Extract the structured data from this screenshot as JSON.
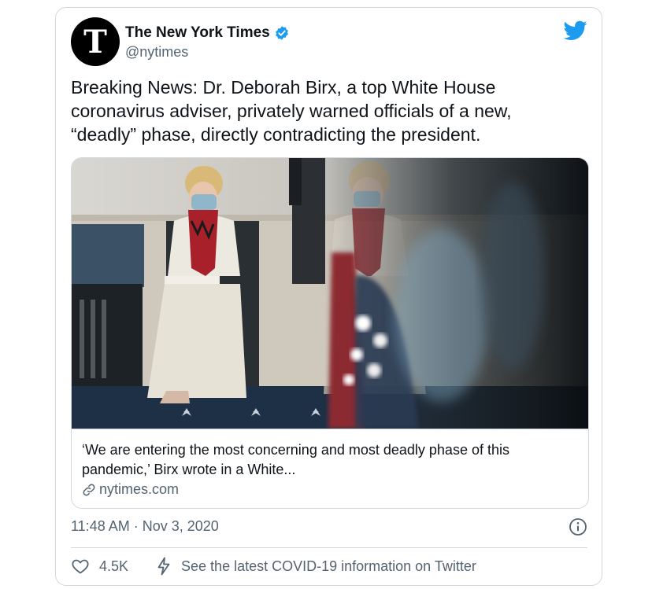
{
  "author": {
    "avatar_glyph": "T",
    "display_name": "The New York Times",
    "handle": "@nytimes",
    "verified": true
  },
  "tweet": {
    "text": "Breaking News: Dr. Deborah Birx, a top White House coronavirus adviser, privately warned officials of a new, “deadly” phase, directly contradicting the president."
  },
  "card": {
    "description": "‘We are entering the most concerning and most deadly phase of this pandemic,’ Birx wrote in a White...",
    "domain": "nytimes.com"
  },
  "meta": {
    "timestamp": "11:48 AM · Nov 3, 2020"
  },
  "actions": {
    "like_count": "4.5K",
    "covid_link": "See the latest COVID-19 information on Twitter"
  },
  "icons": {
    "brand": "twitter-bird-icon",
    "verified": "verified-badge-icon",
    "link": "link-icon",
    "info": "info-icon",
    "like": "heart-icon",
    "covid": "lightning-bolt-icon"
  },
  "colors": {
    "twitter_blue": "#1d9bf0",
    "text_primary": "#0f1419",
    "text_secondary": "#536471",
    "border": "#cfd9de"
  }
}
